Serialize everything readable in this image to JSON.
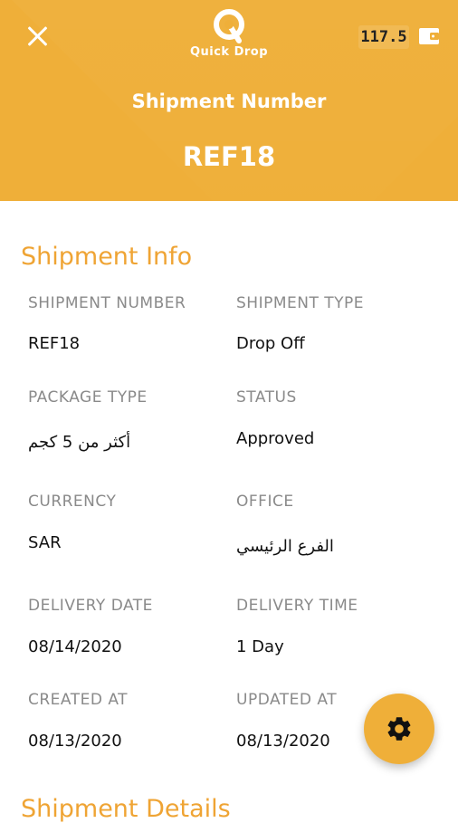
{
  "header": {
    "brand": "Quick Drop",
    "wallet_balance": "117.5",
    "title": "Shipment Number",
    "reference": "REF18"
  },
  "shipment_info": {
    "title": "Shipment Info",
    "fields": {
      "shipment_number": {
        "label": "SHIPMENT NUMBER",
        "value": "REF18"
      },
      "shipment_type": {
        "label": "SHIPMENT TYPE",
        "value": "Drop Off"
      },
      "package_type": {
        "label": "PACKAGE TYPE",
        "value": "أكثر من 5 كجم"
      },
      "status": {
        "label": "STATUS",
        "value": "Approved"
      },
      "currency": {
        "label": "CURRENCY",
        "value": "SAR"
      },
      "office": {
        "label": "OFFICE",
        "value": "الفرع الرئيسي"
      },
      "delivery_date": {
        "label": "DELIVERY DATE",
        "value": "08/14/2020"
      },
      "delivery_time": {
        "label": "DELIVERY TIME",
        "value": "1 Day"
      },
      "created_at": {
        "label": "CREATED AT",
        "value": "08/13/2020"
      },
      "updated_at": {
        "label": "UPDATED AT",
        "value": "08/13/2020"
      }
    }
  },
  "shipment_details": {
    "title": "Shipment Details"
  },
  "colors": {
    "accent": "#EFAF39",
    "section_title": "#EFA434",
    "label": "#8a8a8a"
  },
  "icons": {
    "close": "close-icon",
    "wallet": "wallet-icon",
    "settings": "gear-icon",
    "logo": "logo-q-icon"
  }
}
